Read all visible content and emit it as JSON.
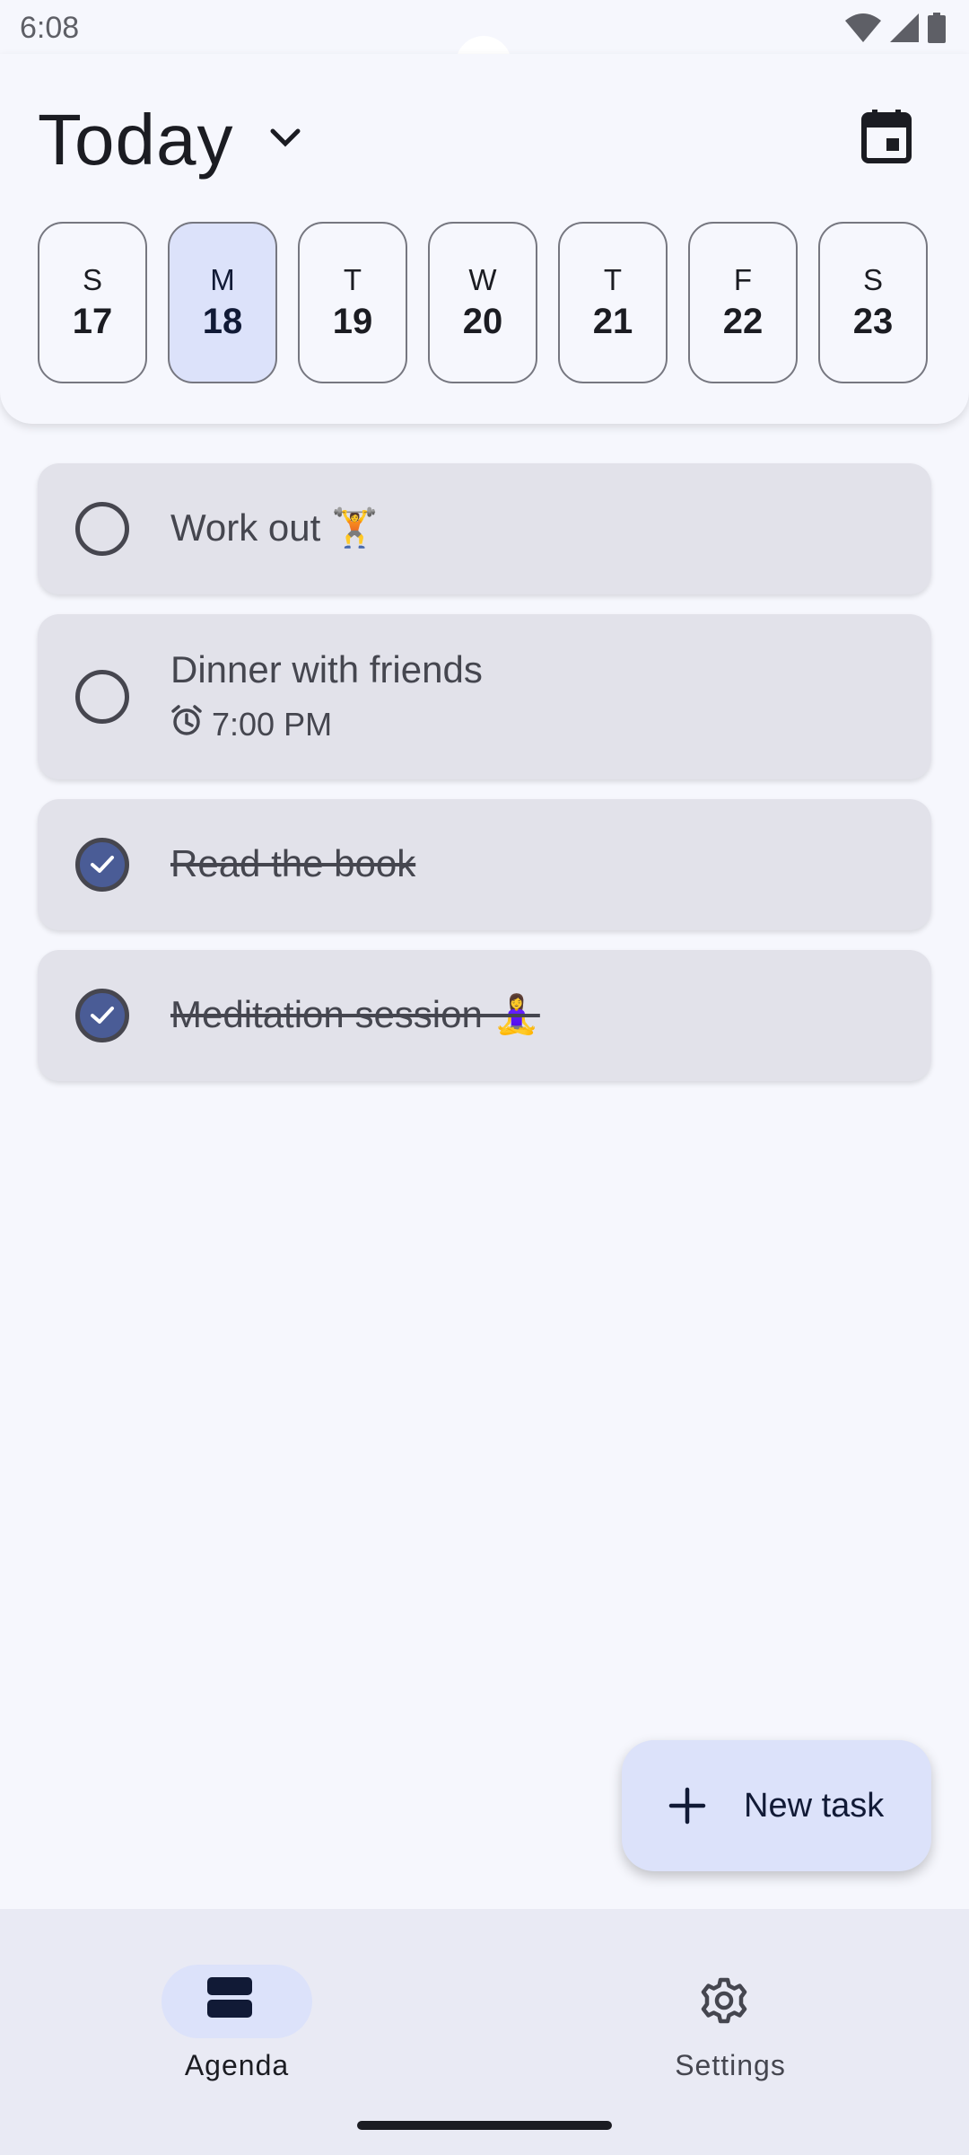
{
  "status_bar": {
    "time": "6:08",
    "icons": [
      "wifi-icon",
      "cellular-signal-icon",
      "battery-icon"
    ]
  },
  "header": {
    "title": "Today",
    "dropdown_icon": "chevron-down-icon",
    "calendar_icon": "calendar-icon"
  },
  "days": [
    {
      "letter": "S",
      "number": "17"
    },
    {
      "letter": "M",
      "number": "18"
    },
    {
      "letter": "T",
      "number": "19"
    },
    {
      "letter": "W",
      "number": "20"
    },
    {
      "letter": "T",
      "number": "21"
    },
    {
      "letter": "F",
      "number": "22"
    },
    {
      "letter": "S",
      "number": "23"
    }
  ],
  "selected_day_index": 1,
  "tasks": [
    {
      "title": "Work out 🏋️",
      "completed": false
    },
    {
      "title": "Dinner with friends",
      "time": "7:00 PM",
      "time_icon": "alarm-icon",
      "completed": false
    },
    {
      "title": "Read the book",
      "completed": true
    },
    {
      "title": "Meditation session 🧘‍♀️",
      "completed": true
    }
  ],
  "fab": {
    "label": "New task",
    "icon": "plus-icon"
  },
  "bottom_nav": {
    "items": [
      {
        "label": "Agenda",
        "icon": "agenda-icon",
        "active": true
      },
      {
        "label": "Settings",
        "icon": "gear-icon",
        "active": false
      }
    ]
  },
  "colors": {
    "background": "#f6f7fd",
    "card": "#e2e2ea",
    "accent": "#4a5c96",
    "selected": "#dce2fa",
    "nav_background": "#e9eaf4"
  }
}
